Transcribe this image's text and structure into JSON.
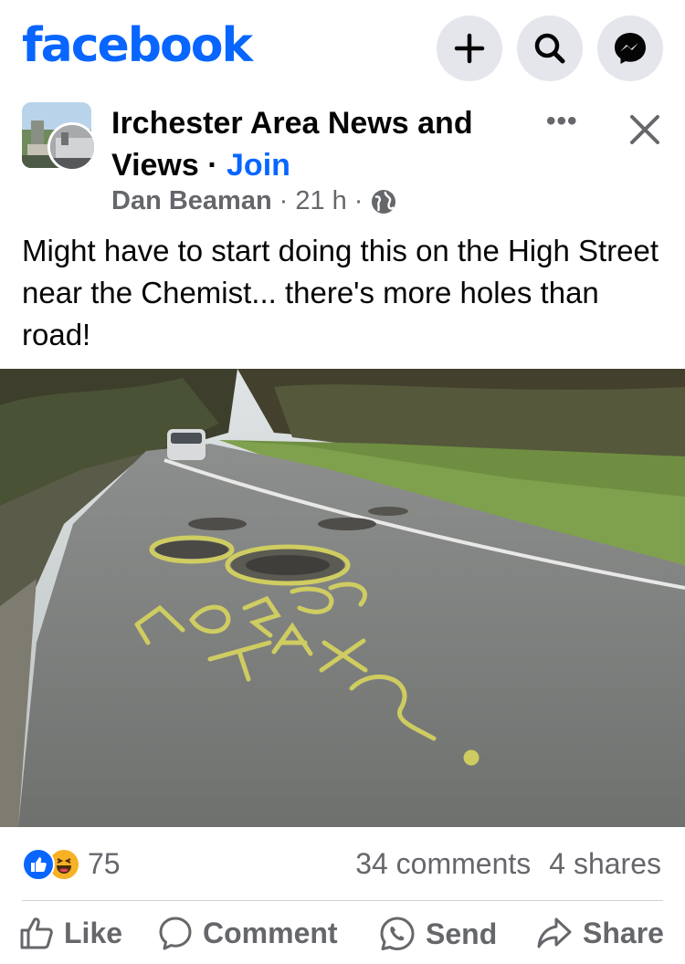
{
  "app": {
    "logo_text": "facebook",
    "brand_color": "#0866ff"
  },
  "topbar": {
    "icons": [
      "plus-icon",
      "search-icon",
      "messenger-icon"
    ]
  },
  "post": {
    "group_name": "Irchester Area News and Views",
    "separator": "·",
    "join_label": "Join",
    "author": "Dan Beaman",
    "time": "21 h",
    "visibility_icon": "globe-icon",
    "more_label": "•••",
    "text": "Might have to start doing this on the High Street near the Chemist... there's more holes than road!",
    "photo_icon": "road-photo"
  },
  "stats": {
    "reaction_count": "75",
    "comments": "34 comments",
    "shares": "4 shares"
  },
  "actions": {
    "like": "Like",
    "comment": "Comment",
    "send": "Send",
    "share": "Share"
  }
}
